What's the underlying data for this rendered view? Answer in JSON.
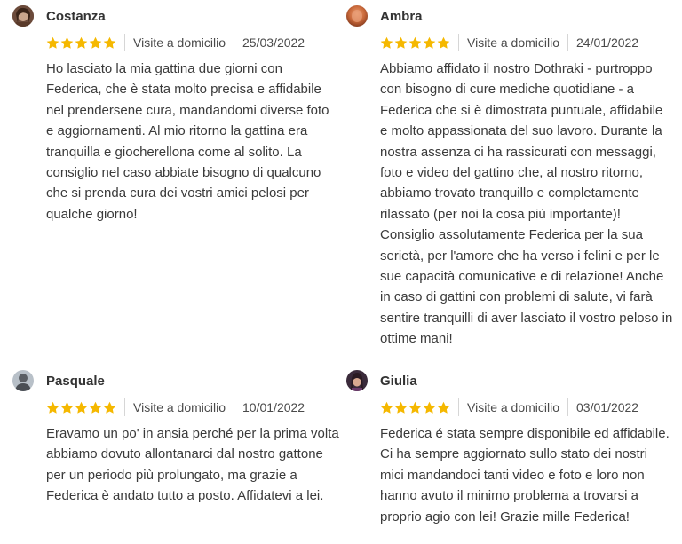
{
  "reviews": [
    {
      "name": "Costanza",
      "avatar_icon": "user-avatar-dark-hair",
      "rating": 5,
      "service": "Visite a domicilio",
      "date": "25/03/2022",
      "text": "Ho lasciato la mia gattina due giorni con Federica, che è stata molto precisa e affidabile nel prendersene cura, mandandomi diverse foto e aggiornamenti. Al mio ritorno la gattina era tranquilla e giocherellona come al solito. La consiglio nel caso abbiate bisogno di qualcuno che si prenda cura dei vostri amici pelosi per qualche giorno!"
    },
    {
      "name": "Ambra",
      "avatar_icon": "user-avatar-orange",
      "rating": 5,
      "service": "Visite a domicilio",
      "date": "24/01/2022",
      "text": "Abbiamo affidato il nostro Dothraki - purtroppo con bisogno di cure mediche quotidiane - a Federica che si è dimostrata puntuale, affidabile e molto appassionata del suo lavoro. Durante la nostra assenza ci ha rassicurati con messaggi, foto e video del gattino che, al nostro ritorno, abbiamo trovato tranquillo e completamente rilassato (per noi la cosa più importante)! Consiglio assolutamente Federica per la sua serietà, per l'amore che ha verso i felini e per le sue capacità comunicative e di relazione! Anche in caso di gattini con problemi di salute, vi farà sentire tranquilli di aver lasciato il vostro peloso in ottime mani!"
    },
    {
      "name": "Pasquale",
      "avatar_icon": "user-avatar-grey",
      "rating": 5,
      "service": "Visite a domicilio",
      "date": "10/01/2022",
      "text": "Eravamo un po' in ansia perché per la prima volta abbiamo dovuto allontanarci dal nostro gattone per un periodo più prolungato, ma grazie a Federica è andato tutto a posto. Affidatevi a lei."
    },
    {
      "name": "Giulia",
      "avatar_icon": "user-avatar-purple",
      "rating": 5,
      "service": "Visite a domicilio",
      "date": "03/01/2022",
      "text": "Federica é stata sempre disponibile ed affidabile. Ci ha sempre aggiornato sullo stato dei nostri mici mandandoci tanti video e foto e loro non hanno avuto il minimo problema a trovarsi a proprio agio con lei! Grazie mille Federica!"
    }
  ],
  "colors": {
    "star": "#f5b800",
    "separator": "#d6d6d6",
    "text": "#3a3a3a"
  }
}
